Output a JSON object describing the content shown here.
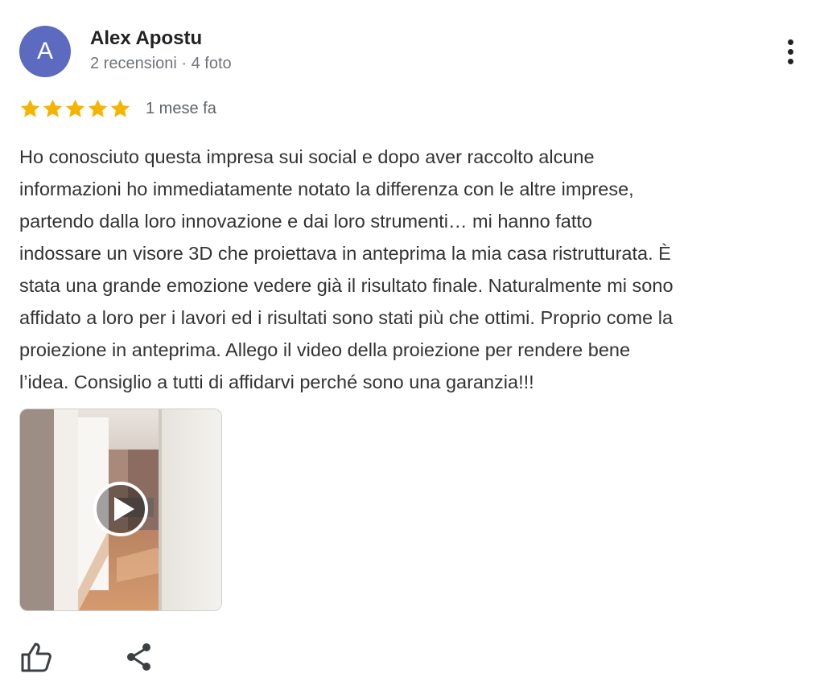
{
  "review": {
    "author": {
      "initial": "A",
      "name": "Alex Apostu",
      "meta": "2 recensioni · 4 foto",
      "avatar_color": "#5c6bc0"
    },
    "rating": {
      "stars": 5,
      "max_stars": 5,
      "star_color": "#f4b400",
      "date": "1 mese fa"
    },
    "text": "Ho conosciuto questa impresa sui social e dopo aver raccolto alcune\ninformazioni ho immediatamente notato la differenza con le altre imprese,\npartendo dalla loro innovazione e dai loro strumenti… mi hanno fatto\nindossare un visore 3D che proiettava in anteprima la mia casa ristrutturata. È\nstata una grande emozione vedere già il risultato finale. Naturalmente mi sono\naffidato a loro per i lavori ed i risultati sono stati più che ottimi. Proprio come la\nproiezione in anteprima. Allego il video della proiezione per rendere bene\nl’idea. Consiglio a tutti di affidarvi perché sono una garanzia!!!",
    "media": {
      "type": "video",
      "icon": "play-icon"
    },
    "actions": {
      "like_icon": "thumbs-up-icon",
      "share_icon": "share-icon",
      "more_icon": "more-vertical-icon"
    }
  }
}
